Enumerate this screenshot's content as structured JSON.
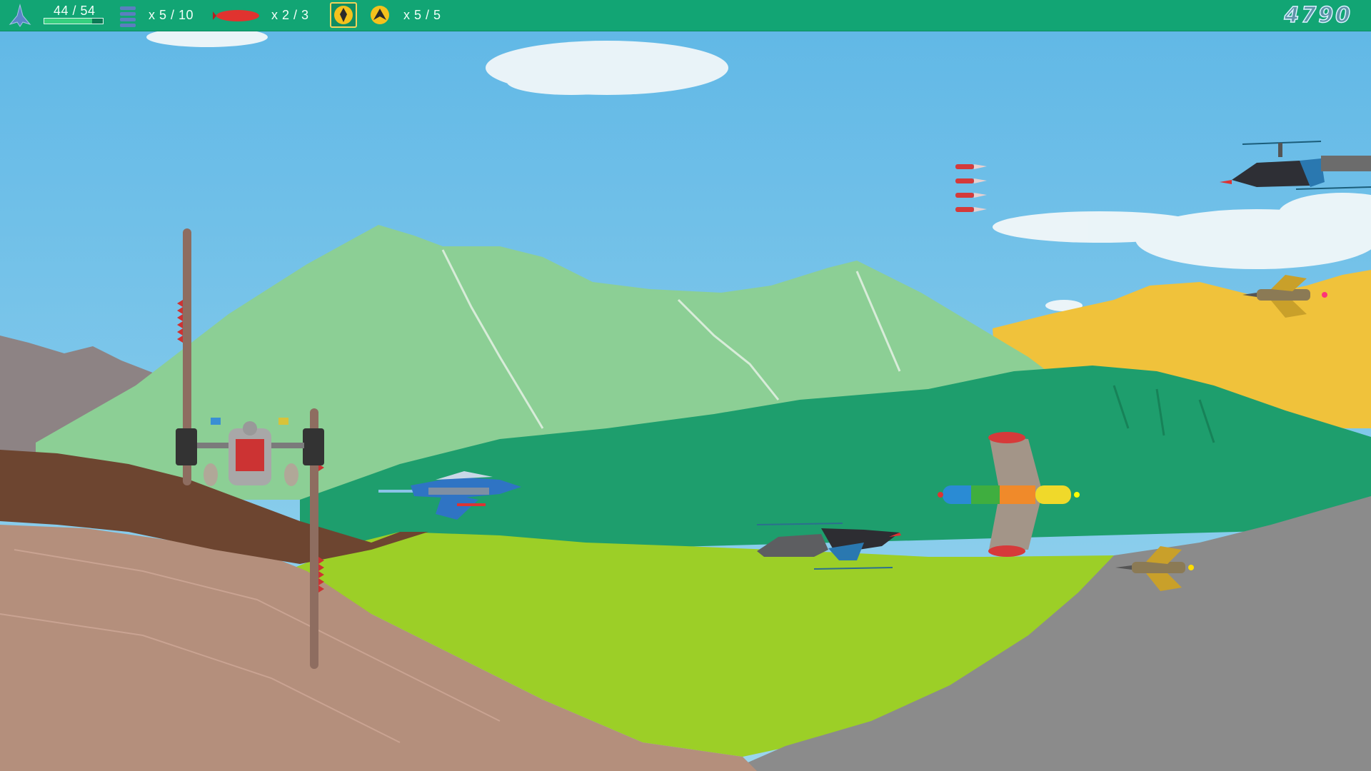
{
  "hud": {
    "health_text": "44 / 54",
    "health_fraction": 0.815,
    "missiles_text": "x 5 / 10",
    "bombs_text": "x 2 / 3",
    "special_text": "x 5 / 5",
    "score": "4790",
    "icons": [
      "player-ship-icon",
      "missile-stack-icon",
      "bomb-icon",
      "special-ability-icon-1",
      "special-ability-icon-2"
    ]
  },
  "colors": {
    "hud_bar": "#12a574",
    "sky": "#7cc7ea",
    "mountain_green": "#8ccf95",
    "forest": "#1e9e6d",
    "meadow": "#9ccf27",
    "earth": "#b48f7c",
    "dirt": "#6d4530",
    "rock": "#8b8b8b",
    "yellow_hills": "#f0c23b"
  }
}
